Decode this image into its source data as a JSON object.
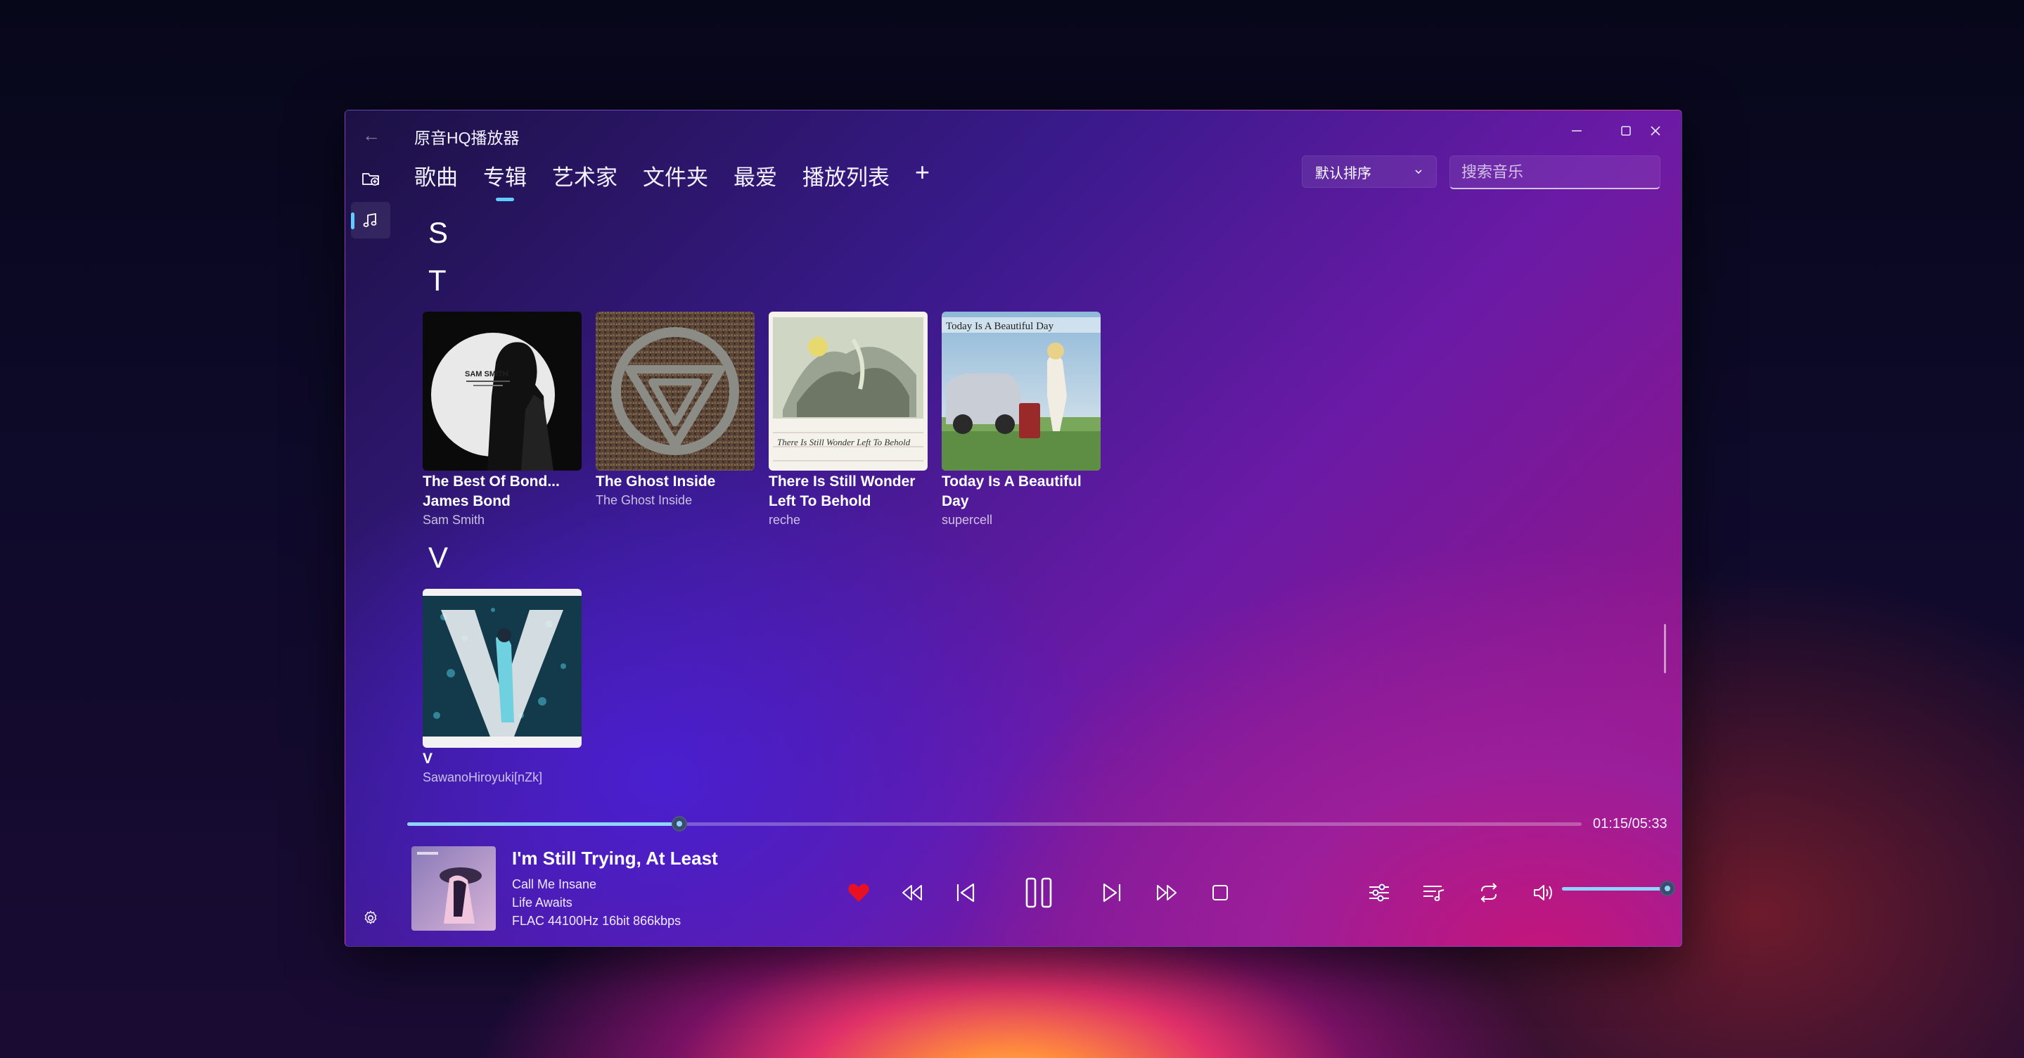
{
  "app": {
    "title": "原音HQ播放器"
  },
  "window_controls": {
    "minimize_icon": "minimize-icon",
    "maximize_icon": "maximize-icon",
    "close_icon": "close-icon"
  },
  "sidebar": {
    "items": [
      {
        "name": "folder-add",
        "icon": "folder-add-icon"
      },
      {
        "name": "music",
        "icon": "music-note-icon",
        "active": true
      },
      {
        "name": "settings",
        "icon": "gear-icon"
      }
    ]
  },
  "tabs": [
    {
      "label": "歌曲",
      "active": false
    },
    {
      "label": "专辑",
      "active": true
    },
    {
      "label": "艺术家",
      "active": false
    },
    {
      "label": "文件夹",
      "active": false
    },
    {
      "label": "最爱",
      "active": false
    },
    {
      "label": "播放列表",
      "active": false
    }
  ],
  "tab_add_label": "+",
  "sort": {
    "selected": "默认排序"
  },
  "search": {
    "placeholder": "搜索音乐",
    "value": ""
  },
  "sections": [
    {
      "letter": "S",
      "albums": []
    },
    {
      "letter": "T",
      "albums": [
        {
          "title": "The Best Of Bond... James Bond",
          "artist": "Sam Smith"
        },
        {
          "title": "The Ghost Inside",
          "artist": "The Ghost Inside"
        },
        {
          "title": "There Is Still Wonder Left To Behold",
          "artist": "reche"
        },
        {
          "title": "Today Is A Beautiful Day",
          "artist": "supercell"
        }
      ]
    },
    {
      "letter": "V",
      "albums": [
        {
          "title": "V",
          "artist": "SawanoHiroyuki[nZk]"
        }
      ]
    }
  ],
  "cover_text": {
    "sam_smith": "SAM SMITH",
    "reche": "There Is Still Wonder Left To Behold",
    "supercell": "Today Is A Beautiful Day"
  },
  "player": {
    "progress_fraction": 0.232,
    "time": "01:15/05:33",
    "now_playing": {
      "title": "I'm Still Trying, At Least",
      "artist": "Call Me Insane",
      "album": "Life Awaits",
      "format": "FLAC 44100Hz 16bit 866kbps"
    },
    "favorite": true,
    "volume_fraction": 1.0
  },
  "colors": {
    "accent": "#60cdff",
    "favorite": "#e81123",
    "progress": "#8fd4ff"
  }
}
